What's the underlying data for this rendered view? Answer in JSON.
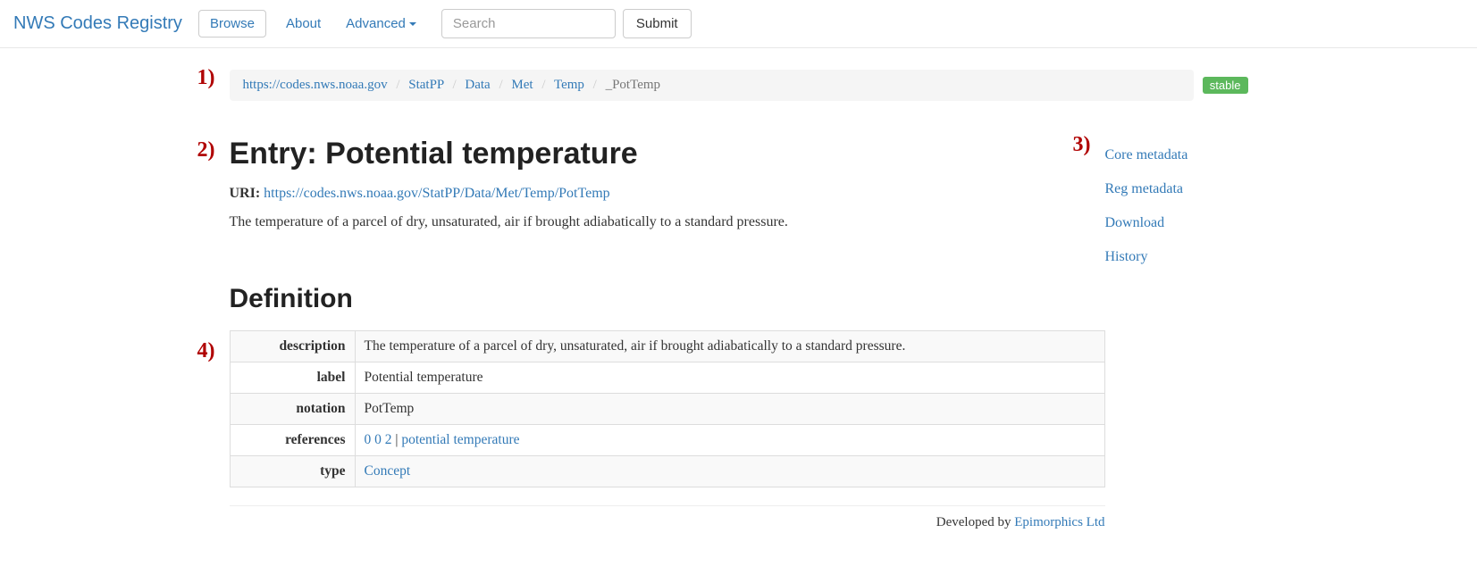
{
  "nav": {
    "brand": "NWS Codes Registry",
    "browse": "Browse",
    "about": "About",
    "advanced": "Advanced",
    "search_placeholder": "Search",
    "submit": "Submit"
  },
  "markers": {
    "m1": "1)",
    "m2": "2)",
    "m3": "3)",
    "m4": "4)"
  },
  "breadcrumb": {
    "root": "https://codes.nws.noaa.gov",
    "parts": [
      "StatPP",
      "Data",
      "Met",
      "Temp"
    ],
    "current": "_PotTemp"
  },
  "status_badge": "stable",
  "entry": {
    "heading": "Entry: Potential temperature",
    "uri_label": "URI:",
    "uri": "https://codes.nws.noaa.gov/StatPP/Data/Met/Temp/PotTemp",
    "description": "The temperature of a parcel of dry, unsaturated, air if brought adiabatically to a standard pressure."
  },
  "sidebar": {
    "core": "Core metadata",
    "reg": "Reg metadata",
    "download": "Download",
    "history": "History"
  },
  "definition": {
    "heading": "Definition",
    "rows": {
      "description": {
        "label": "description",
        "value": "The temperature of a parcel of dry, unsaturated, air if brought adiabatically to a standard pressure."
      },
      "label": {
        "label": "label",
        "value": "Potential temperature"
      },
      "notation": {
        "label": "notation",
        "value": "PotTemp"
      },
      "references": {
        "label": "references",
        "link1": "0 0 2",
        "sep": " | ",
        "link2": "potential temperature"
      },
      "type": {
        "label": "type",
        "link": "Concept"
      }
    }
  },
  "footer": {
    "text": "Developed by ",
    "link": "Epimorphics Ltd"
  }
}
